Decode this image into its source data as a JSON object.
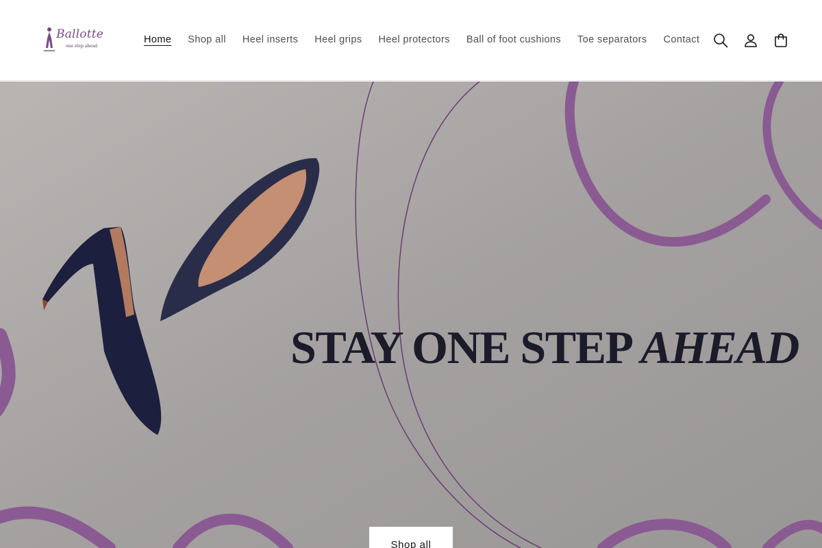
{
  "brand": {
    "name": "Ballotte",
    "tagline": "one step ahead",
    "accent_color": "#7a4a84"
  },
  "nav": {
    "items": [
      {
        "label": "Home",
        "active": true
      },
      {
        "label": "Shop all"
      },
      {
        "label": "Heel inserts"
      },
      {
        "label": "Heel grips"
      },
      {
        "label": "Heel protectors"
      },
      {
        "label": "Ball of foot cushions"
      },
      {
        "label": "Toe separators"
      },
      {
        "label": "Contact"
      }
    ]
  },
  "header_icons": {
    "search": "search-icon",
    "account": "account-icon",
    "cart": "cart-icon"
  },
  "hero": {
    "heading_main": "STAY ONE STEP ",
    "heading_em": "AHEAD",
    "button_label": "Shop all",
    "ribbon_color": "#8a5a92",
    "shoe_color": "#1c1f3d"
  }
}
